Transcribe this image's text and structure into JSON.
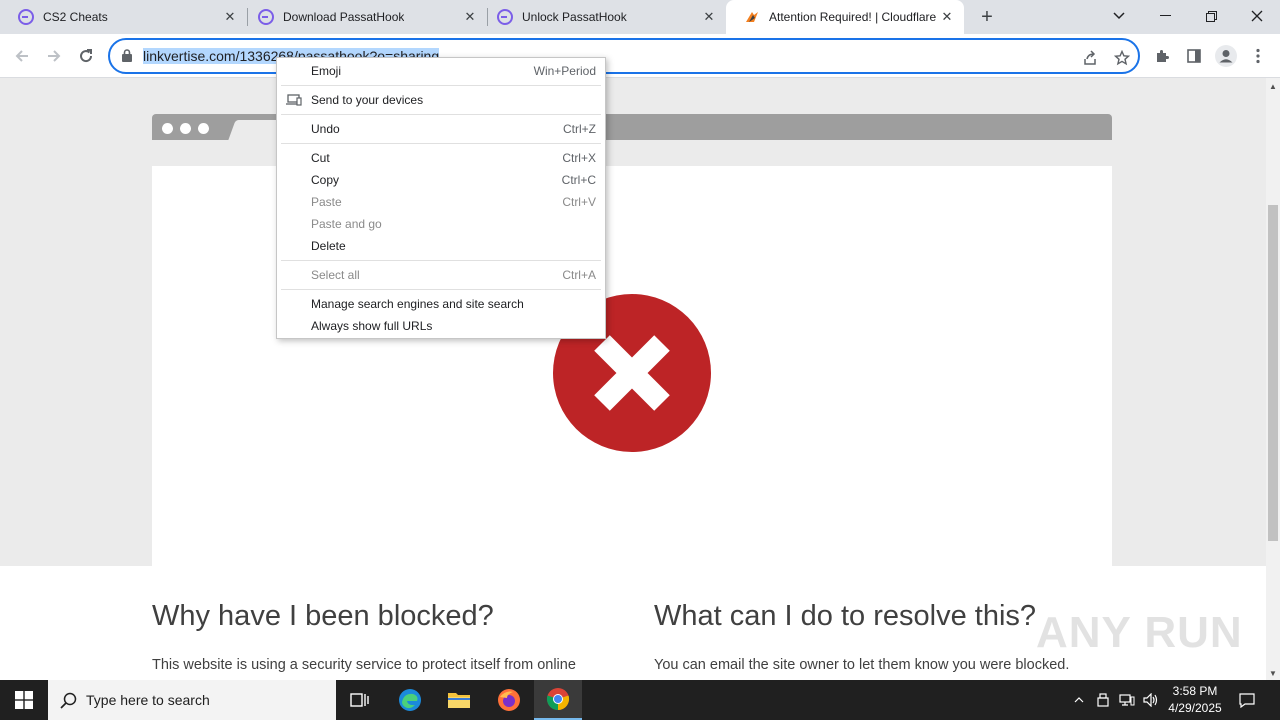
{
  "tabs": [
    {
      "title": "CS2 Cheats",
      "favicon": "linkvertise-icon",
      "active": false
    },
    {
      "title": "Download PassatHook",
      "favicon": "linkvertise-icon",
      "active": false
    },
    {
      "title": "Unlock PassatHook",
      "favicon": "linkvertise-icon",
      "active": false
    },
    {
      "title": "Attention Required! | Cloudflare",
      "favicon": "cloudflare-icon",
      "active": true
    }
  ],
  "address_bar": {
    "url": "linkvertise.com/1336268/passathook?o=sharing"
  },
  "context_menu": {
    "items": [
      {
        "label": "Emoji",
        "shortcut": "Win+Period"
      },
      {
        "label": "Send to your devices",
        "shortcut": ""
      },
      {
        "label": "Undo",
        "shortcut": "Ctrl+Z"
      },
      {
        "label": "Cut",
        "shortcut": "Ctrl+X"
      },
      {
        "label": "Copy",
        "shortcut": "Ctrl+C"
      },
      {
        "label": "Paste",
        "shortcut": "Ctrl+V"
      },
      {
        "label": "Paste and go",
        "shortcut": ""
      },
      {
        "label": "Delete",
        "shortcut": ""
      },
      {
        "label": "Select all",
        "shortcut": "Ctrl+A"
      },
      {
        "label": "Manage search engines and site search",
        "shortcut": ""
      },
      {
        "label": "Always show full URLs",
        "shortcut": ""
      }
    ]
  },
  "page": {
    "why_heading": "Why have I been blocked?",
    "why_text": "This website is using a security service to protect itself from online",
    "resolve_heading": "What can I do to resolve this?",
    "resolve_text": "You can email the site owner to let them know you were blocked."
  },
  "watermark": "ANY RUN",
  "taskbar": {
    "search_placeholder": "Type here to search",
    "time": "3:58 PM",
    "date": "4/29/2025"
  },
  "colors": {
    "accent": "#1a73e8",
    "error_red": "#bd2426",
    "selection": "#b3d7fe"
  }
}
